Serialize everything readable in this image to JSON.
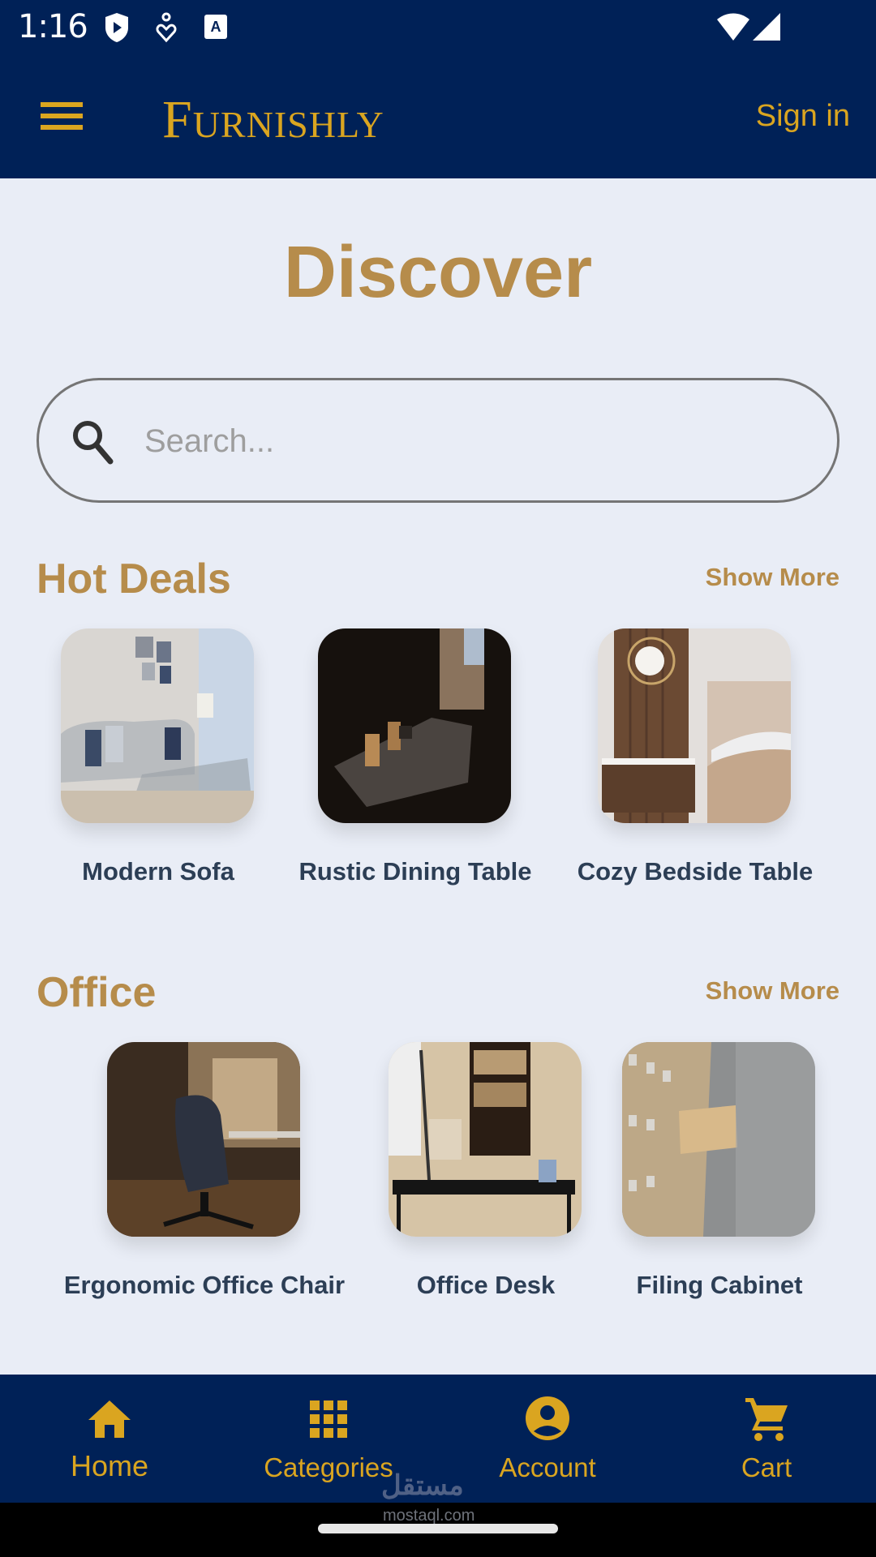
{
  "status_bar": {
    "time": "1:16",
    "left_icons": [
      "shield-play-icon",
      "accessibility-heart-icon",
      "text-a-icon"
    ],
    "right_icons": [
      "wifi-icon",
      "cellular-signal-icon"
    ]
  },
  "app_bar": {
    "menu_icon": "hamburger-menu-icon",
    "logo": "Furnishly",
    "sign_in_label": "Sign in"
  },
  "page": {
    "title": "Discover"
  },
  "search": {
    "placeholder": "Search...",
    "value": "",
    "icon": "search-icon"
  },
  "sections": [
    {
      "title": "Hot Deals",
      "show_more_label": "Show More",
      "items": [
        {
          "label": "Modern Sofa",
          "image": "living-room-sofa-photo"
        },
        {
          "label": "Rustic Dining Table",
          "image": "dark-dining-table-photo"
        },
        {
          "label": "Cozy Bedside Table",
          "image": "bedroom-nightstand-photo"
        }
      ]
    },
    {
      "title": "Office",
      "show_more_label": "Show More",
      "items": [
        {
          "label": "Ergonomic Office Chair",
          "image": "office-chair-photo"
        },
        {
          "label": "Office Desk",
          "image": "office-desk-photo"
        },
        {
          "label": "Filing Cabinet",
          "image": "filing-cabinet-photo"
        }
      ]
    }
  ],
  "bottom_nav": {
    "items": [
      {
        "label": "Home",
        "icon": "home-icon",
        "active": true
      },
      {
        "label": "Categories",
        "icon": "grid-icon",
        "active": false
      },
      {
        "label": "Account",
        "icon": "account-circle-icon",
        "active": false
      },
      {
        "label": "Cart",
        "icon": "cart-icon",
        "active": false
      }
    ]
  },
  "watermark": {
    "arabic": "مستقل",
    "latin": "mostaql.com"
  },
  "colors": {
    "primary_navy": "#002157",
    "accent_gold": "#daa520",
    "heading_brown": "#b68c4b",
    "background": "#e9edf6",
    "item_label": "#2c3e55"
  }
}
